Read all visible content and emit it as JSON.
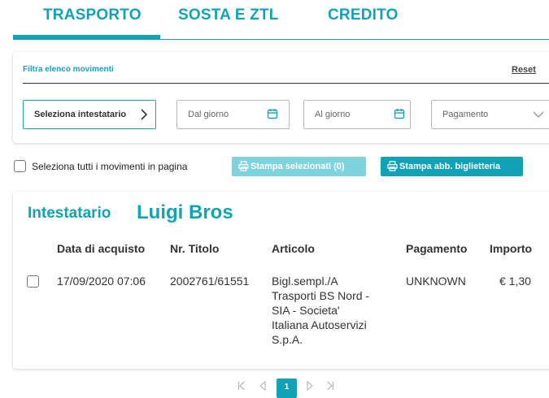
{
  "tabs": [
    {
      "label": "TRASPORTO",
      "active": true
    },
    {
      "label": "SOSTA E ZTL",
      "active": false
    },
    {
      "label": "CREDITO",
      "active": false
    }
  ],
  "filter": {
    "title": "Filtra elenco movimenti",
    "reset": "Reset",
    "owner_select": "Seleziona intestatario",
    "from_day": "Dal giorno",
    "to_day": "Al giorno",
    "payment": "Pagamento"
  },
  "actions": {
    "select_all": "Seleziona tutti i movimenti in pagina",
    "print_selected": "Stampa selezionati (0)",
    "print_tickets": "Stampa abb. biglietteria"
  },
  "result": {
    "owner_label": "Intestatario",
    "owner_name": "Luigi Bros",
    "columns": [
      "Data di acquisto",
      "Nr. Titolo",
      "Articolo",
      "Pagamento",
      "Importo"
    ],
    "rows": [
      {
        "date": "17/09/2020 07:06",
        "number": "2002761/61551",
        "article_lines": [
          "Bigl.sempl./A",
          "Trasporti BS Nord -",
          "SIA - Societa'",
          "Italiana Autoservizi",
          "S.p.A."
        ],
        "payment": "UNKNOWN",
        "amount": "€ 1,30"
      }
    ]
  },
  "pagination": {
    "current": "1"
  },
  "colors": {
    "accent": "#11a3b5",
    "accent_light": "#7fd3dd"
  }
}
